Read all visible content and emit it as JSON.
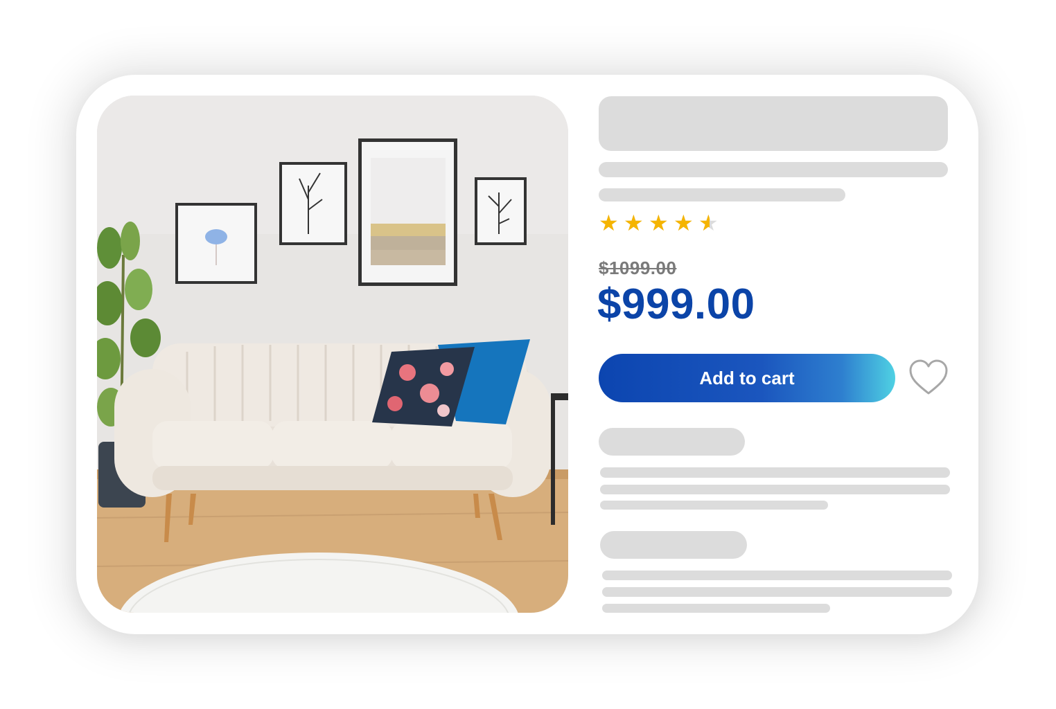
{
  "product": {
    "rating": 4.5,
    "rating_max": 5,
    "star_icon": "star-icon",
    "old_price": "$1099.00",
    "price": "$999.00",
    "add_to_cart_label": "Add to cart",
    "wishlist_icon": "heart-icon",
    "image_subject": "living-room-sofa-photo"
  },
  "colors": {
    "price": "#0b44a8",
    "button_start": "#0c45b0",
    "button_end": "#4fd1e3",
    "star": "#f5b400",
    "skeleton": "#dcdcdc"
  }
}
